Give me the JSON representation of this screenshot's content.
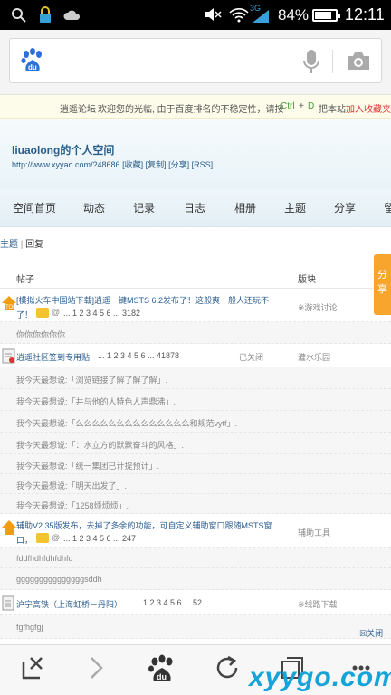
{
  "status_bar": {
    "battery": "84%",
    "time": "12:11",
    "network": "3G",
    "battery_level": 0.84
  },
  "notice": {
    "forum": "逍遥论坛",
    "text": "欢迎您的光临, 由于百度排名的不稳定性，请按",
    "shortcut_ctrl": "Ctrl",
    "plus": "+",
    "shortcut_d": "D",
    "save": "把本站",
    "add_fav": "加入收藏夹"
  },
  "space": {
    "title": "liuaolong的个人空间",
    "url": "http://www.xyyao.com/?48686",
    "links": [
      "[收藏]",
      "[复制]",
      "[分享]",
      "[RSS]"
    ]
  },
  "nav": [
    "空间首页",
    "动态",
    "记录",
    "日志",
    "相册",
    "主题",
    "分享",
    "留"
  ],
  "breadcrumb": {
    "topic": "主题",
    "sep": "|",
    "reply": "回复"
  },
  "table": {
    "col_post": "帖子",
    "col_forum": "版块"
  },
  "share_tab": "分享",
  "rows": [
    {
      "kind": "thread",
      "title_l1": "[模拟火车中国站下载]逍遥一键MSTS 6.2发布了！这般爽一般人还玩不",
      "title_l2": "了！",
      "pages": "...  1  2  3  4  5  6  ...  3182",
      "forum": "※游戏讨论"
    },
    {
      "kind": "reply",
      "text": "你你你你你你"
    },
    {
      "kind": "thread",
      "title_l1": "逍遥社区签到专用贴",
      "pages": "...  1  2  3  4  5  6  ...  41878",
      "closed": "已关闭",
      "forum": "灌水乐园"
    },
    {
      "kind": "reply",
      "text": "我今天最想说:「浏览链接了解了解了解」."
    },
    {
      "kind": "reply",
      "text": "我今天最想说:「井与他的人特色人声鼎沸」."
    },
    {
      "kind": "reply",
      "text": "我今天最想说:「么么么么么么么么么么么么么么和规范vytf」."
    },
    {
      "kind": "reply",
      "text": "我今天最想说:「：水立方的默默奋斗的风格」."
    },
    {
      "kind": "reply",
      "text": "我今天最想说:「统一集团已计提预计」."
    },
    {
      "kind": "reply",
      "text": "我今天最想说:「明天出发了」."
    },
    {
      "kind": "reply",
      "text": "我今天最想说:「1258烦烦烦」."
    },
    {
      "kind": "thread",
      "title_l1": "辅助V2.35版发布，去掉了多余的功能，可自定义辅助窗口跟随MSTS窗",
      "title_l2": "口，",
      "pages": "...  1  2  3  4  5  6  ...  247",
      "forum": "辅助工具"
    },
    {
      "kind": "reply",
      "text": "fddfhdhfdhfdhfd"
    },
    {
      "kind": "reply",
      "text": "gggggggggggggggsddh"
    },
    {
      "kind": "thread",
      "title_l1": "沪宁高铁（上海虹桥－丹阳）",
      "pages": "...  1  2  3  4  5  6  ...  52",
      "forum": "※线路下载"
    },
    {
      "kind": "reply",
      "text": "fgfhgfgj"
    }
  ],
  "close_ad": "关闭",
  "watermark": "xyygo.com",
  "icons": [
    "search-icon",
    "lock-icon",
    "cloud-icon",
    "mute-icon",
    "wifi-icon",
    "signal-icon",
    "baidu-logo-icon",
    "mic-icon",
    "camera-icon",
    "close-tab-icon",
    "forward-icon",
    "baidu-paw-icon",
    "refresh-icon",
    "tabs-icon",
    "more-icon"
  ]
}
